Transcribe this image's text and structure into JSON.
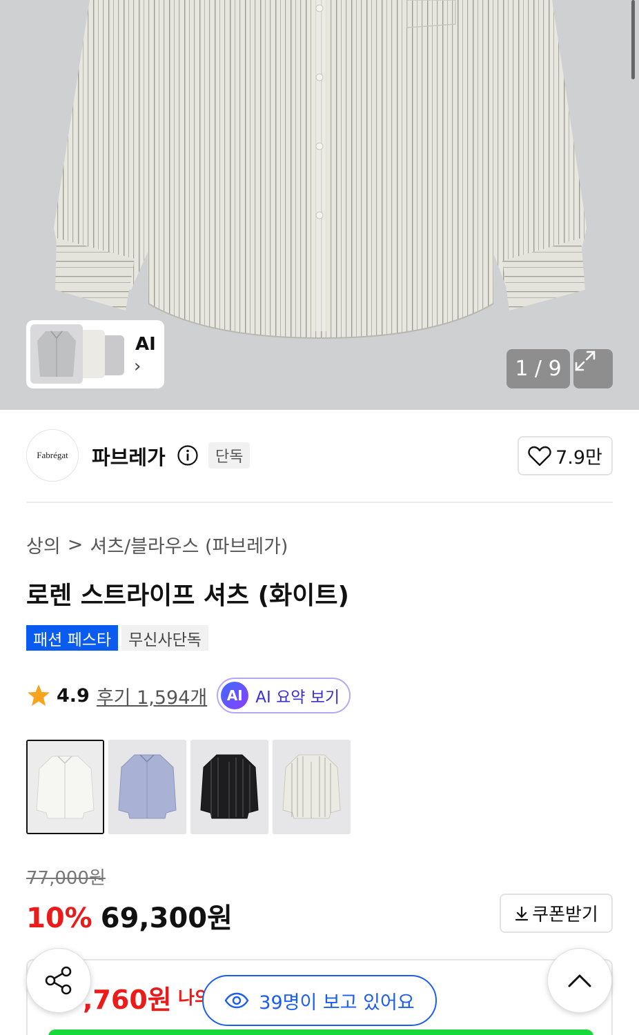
{
  "gallery": {
    "ai_label": "AI",
    "ai_chevron": "›",
    "counter": "1 / 9",
    "expand_icon": "expand-icon"
  },
  "brand": {
    "logo_text": "Fabrégat",
    "name": "파브레가",
    "exclusive_badge": "단독",
    "likes": "7.9만"
  },
  "breadcrumb": {
    "level1": "상의",
    "separator": ">",
    "level2": "셔츠/블라우스 (파브레가)"
  },
  "product": {
    "title": "로렌 스트라이프 셔츠 (화이트)",
    "tags": [
      "패션 페스타",
      "무신사단독"
    ],
    "rating": "4.9",
    "reviews": "후기 1,594개",
    "ai_summary_badge": "AI",
    "ai_summary_label": "AI 요약 보기",
    "colors": [
      "white",
      "blue",
      "black",
      "ivory-stripe"
    ],
    "original_price": "77,000원",
    "discount": "10%",
    "price": "69,300원",
    "coupon_label": "쿠폰받기"
  },
  "benefit": {
    "price": ",760원",
    "sub": "나의"
  },
  "floating": {
    "viewers": "39명이 보고 있어요"
  },
  "colors": {
    "accent_blue": "#0a5cf0",
    "sale_red": "#ea1b1b",
    "green": "#19d839"
  }
}
